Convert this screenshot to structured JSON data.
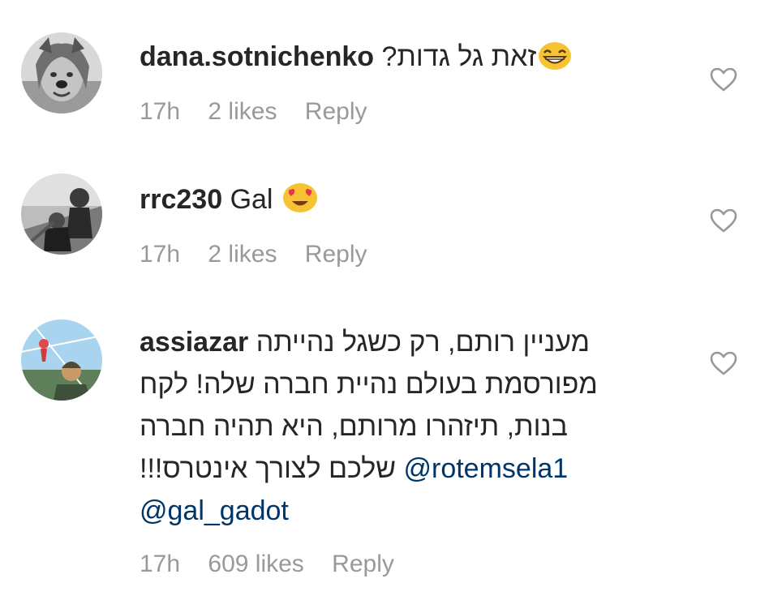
{
  "comments": [
    {
      "username": "dana.sotnichenko",
      "text": "זאת גל גדות?",
      "emoji": "grinning-face-with-smiling-eyes",
      "time": "17h",
      "likes": "2 likes",
      "reply": "Reply"
    },
    {
      "username": "rrc230",
      "text": "Gal",
      "emoji": "smiling-face-with-heart-eyes",
      "time": "17h",
      "likes": "2 likes",
      "reply": "Reply"
    },
    {
      "username": "assiazar",
      "lines": [
        "מעניין רותם, רק כשגל נהייתה",
        "מפורסמת בעולם נהיית חברה שלה! לקח",
        "בנות, תיזהרו מרותם, היא תהיה חברה",
        "שלכם לצורך אינטרס!!!"
      ],
      "mentions": [
        "@rotemsela1",
        "@gal_gadot"
      ],
      "time": "17h",
      "likes": "609 likes",
      "reply": "Reply"
    }
  ],
  "colors": {
    "text": "#262626",
    "meta": "#999999",
    "mention": "#003569",
    "heart": "#999999"
  }
}
